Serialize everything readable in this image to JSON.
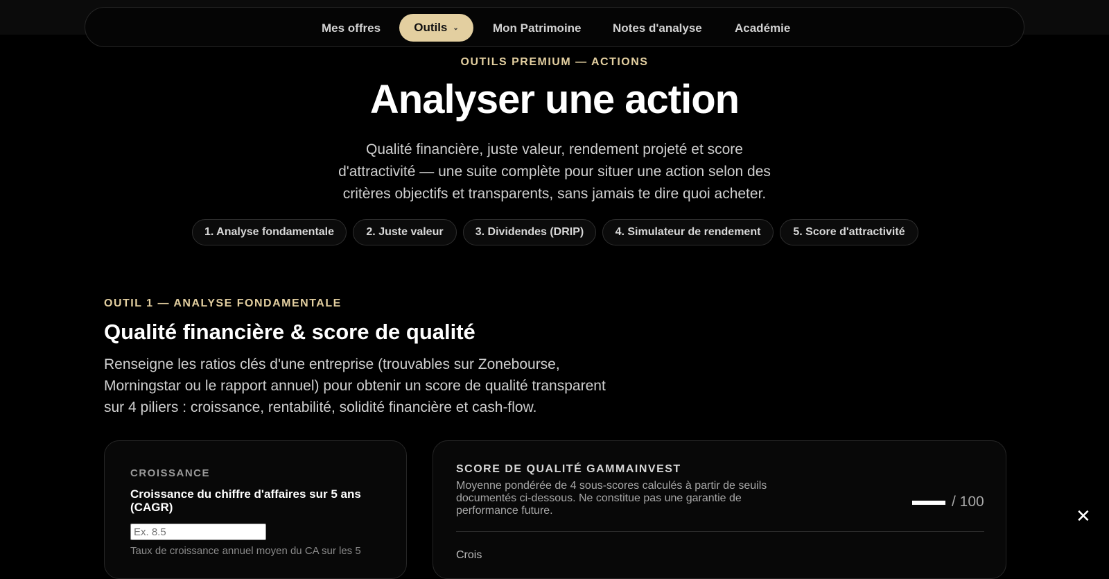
{
  "nav": {
    "items": [
      "Mes offres",
      "Outils",
      "Mon Patrimoine",
      "Notes d'analyse",
      "Académie"
    ],
    "active": "Outils"
  },
  "hero": {
    "eyebrow": "OUTILS PREMIUM — ACTIONS",
    "title": "Analyser une action",
    "subtitle": "Qualité financière, juste valeur, rendement projeté et score d'attractivité — une suite complète pour situer une action selon des critères objectifs et transparents, sans jamais te dire quoi acheter."
  },
  "chips": [
    "1. Analyse fondamentale",
    "2. Juste valeur",
    "3. Dividendes (DRIP)",
    "4. Simulateur de rendement",
    "5. Score d'attractivité"
  ],
  "section": {
    "eyebrow": "OUTIL 1 — ANALYSE FONDAMENTALE",
    "title": "Qualité financière & score de qualité",
    "description": "Renseigne les ratios clés d'une entreprise (trouvables sur Zonebourse, Morningstar ou le rapport annuel) pour obtenir un score de qualité transparent sur 4 piliers : croissance, rentabilité, solidité financière et cash-flow."
  },
  "growth_card": {
    "label": "CROISSANCE",
    "field_title": "Croissance du chiffre d'affaires sur 5 ans (CAGR)",
    "placeholder": "Ex. 8.5",
    "value": "",
    "help": "Taux de croissance annuel moyen du CA sur les 5"
  },
  "score_card": {
    "title": "SCORE DE QUALITÉ GAMMAINVEST",
    "description": "Moyenne pondérée de 4 sous-scores calculés à partir de seuils documentés ci-dessous. Ne constitue pas une garantie de performance future.",
    "score_placeholder": "—",
    "max": "/ 100",
    "first_pillar": "Crois"
  },
  "icons": {
    "close": "close-icon"
  }
}
